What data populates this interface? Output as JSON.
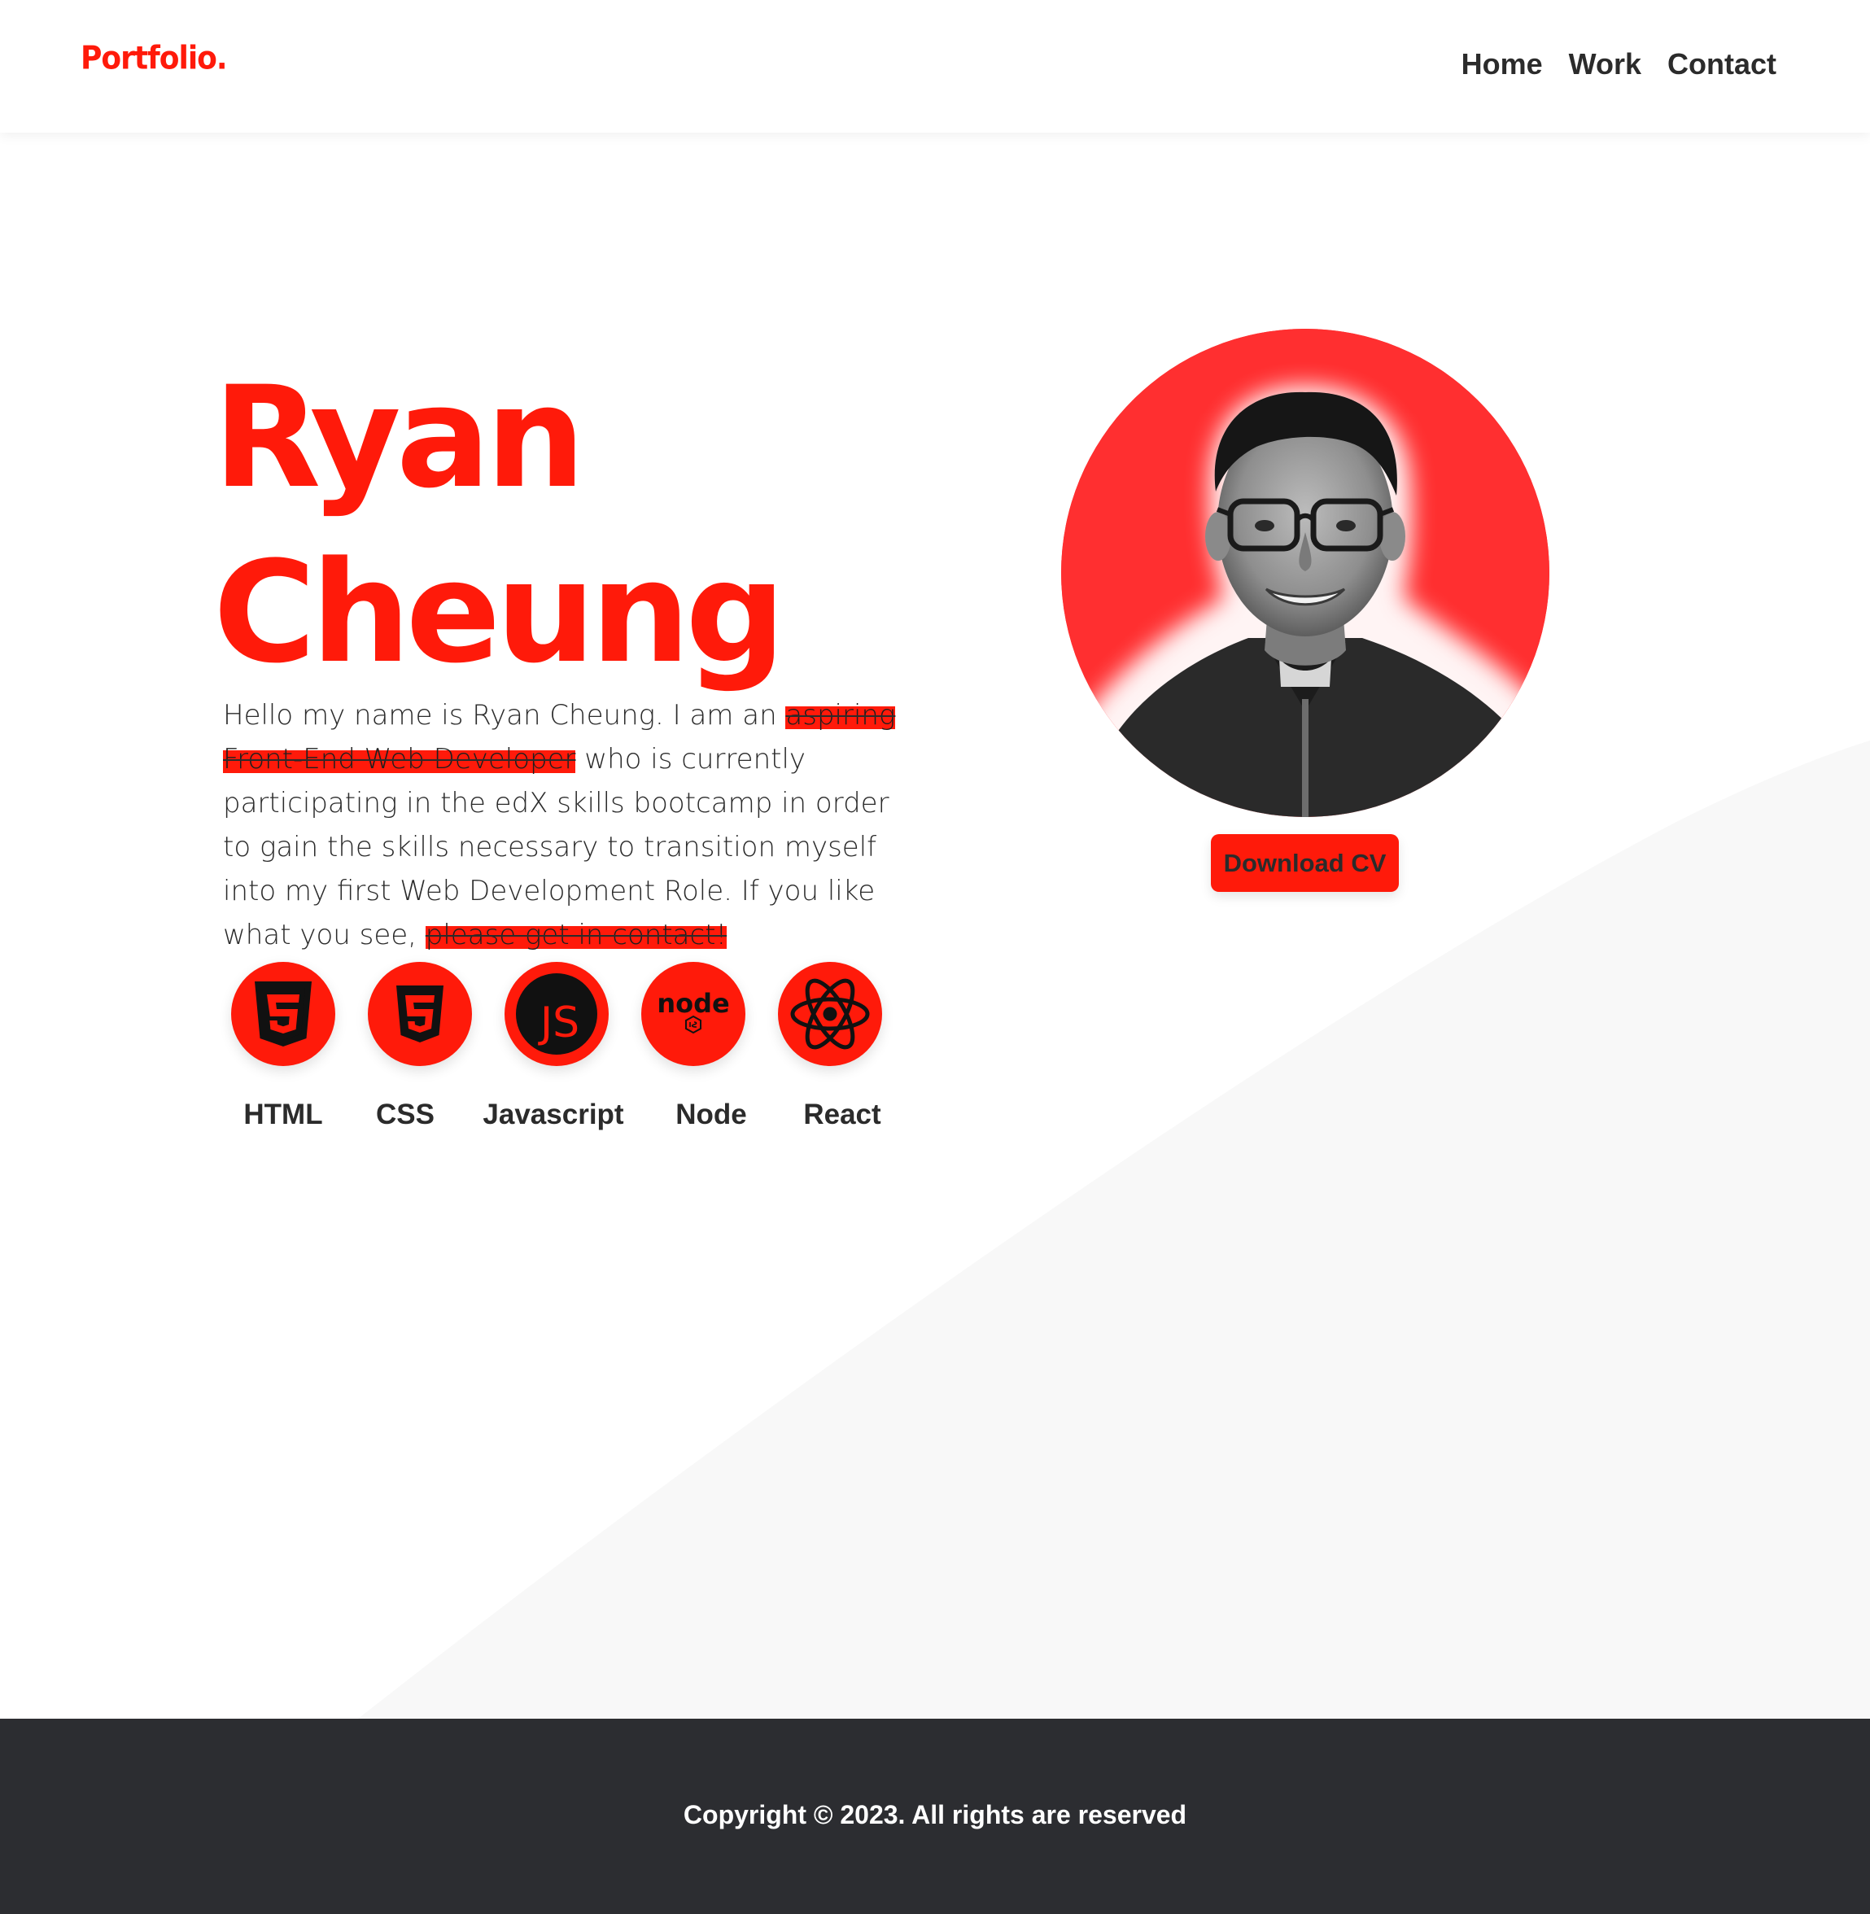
{
  "brand": {
    "logo_text": "Portfolio.",
    "accent_color": "#ff1a0a"
  },
  "nav": {
    "items": [
      {
        "label": "Home"
      },
      {
        "label": "Work"
      },
      {
        "label": "Contact"
      }
    ]
  },
  "hero": {
    "first_name": "Ryan",
    "last_name": "Cheung",
    "intro": {
      "part1": "Hello my name is Ryan Cheung. I am an ",
      "highlight1": "aspiring Front-End Web Developer",
      "part2": " who is currently participating in the edX skills bootcamp in order to gain the skills necessary to transition myself into my first Web Development Role. If you like what you see, ",
      "highlight2": "please get in contact!"
    },
    "download_button": "Download CV",
    "photo_icon": "profile-photo-grayscale"
  },
  "skills": [
    {
      "label": "HTML",
      "icon": "html5-icon"
    },
    {
      "label": "CSS",
      "icon": "css3-icon"
    },
    {
      "label": "Javascript",
      "icon": "javascript-icon",
      "badge": "JS"
    },
    {
      "label": "Node",
      "icon": "nodejs-icon",
      "badge": "node"
    },
    {
      "label": "React",
      "icon": "react-icon"
    }
  ],
  "footer": {
    "copyright": "Copyright © 2023. All rights are reserved",
    "background_color": "#2c2d31"
  }
}
